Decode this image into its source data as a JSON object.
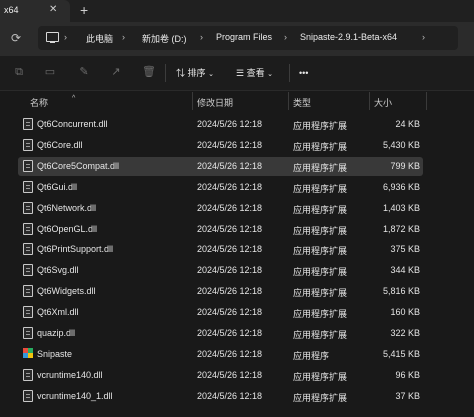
{
  "tab": {
    "title": "x64",
    "close_glyph": "✕",
    "new_glyph": "+"
  },
  "breadcrumb": {
    "items": [
      "此电脑",
      "新加卷 (D:)",
      "Program Files",
      "Snipaste-2.9.1-Beta-x64"
    ],
    "separator": "›",
    "trailing": "›"
  },
  "toolbar": {
    "sort_label": "排序",
    "view_label": "查看",
    "more_label": "•••",
    "icons": [
      "copy-icon",
      "paste-icon",
      "rename-icon",
      "share-icon",
      "delete-icon"
    ]
  },
  "columns": {
    "name": "名称",
    "modified": "修改日期",
    "type": "类型",
    "size": "大小"
  },
  "files": [
    {
      "name": "Qt6Concurrent.dll",
      "modified": "2024/5/26 12:18",
      "type": "应用程序扩展",
      "size": "24 KB",
      "icon": "dll-file-icon"
    },
    {
      "name": "Qt6Core.dll",
      "modified": "2024/5/26 12:18",
      "type": "应用程序扩展",
      "size": "5,430 KB",
      "icon": "dll-file-icon"
    },
    {
      "name": "Qt6Core5Compat.dll",
      "modified": "2024/5/26 12:18",
      "type": "应用程序扩展",
      "size": "799 KB",
      "icon": "dll-file-icon",
      "selected": true
    },
    {
      "name": "Qt6Gui.dll",
      "modified": "2024/5/26 12:18",
      "type": "应用程序扩展",
      "size": "6,936 KB",
      "icon": "dll-file-icon"
    },
    {
      "name": "Qt6Network.dll",
      "modified": "2024/5/26 12:18",
      "type": "应用程序扩展",
      "size": "1,403 KB",
      "icon": "dll-file-icon"
    },
    {
      "name": "Qt6OpenGL.dll",
      "modified": "2024/5/26 12:18",
      "type": "应用程序扩展",
      "size": "1,872 KB",
      "icon": "dll-file-icon"
    },
    {
      "name": "Qt6PrintSupport.dll",
      "modified": "2024/5/26 12:18",
      "type": "应用程序扩展",
      "size": "375 KB",
      "icon": "dll-file-icon"
    },
    {
      "name": "Qt6Svg.dll",
      "modified": "2024/5/26 12:18",
      "type": "应用程序扩展",
      "size": "344 KB",
      "icon": "dll-file-icon"
    },
    {
      "name": "Qt6Widgets.dll",
      "modified": "2024/5/26 12:18",
      "type": "应用程序扩展",
      "size": "5,816 KB",
      "icon": "dll-file-icon"
    },
    {
      "name": "Qt6Xml.dll",
      "modified": "2024/5/26 12:18",
      "type": "应用程序扩展",
      "size": "160 KB",
      "icon": "dll-file-icon"
    },
    {
      "name": "quazip.dll",
      "modified": "2024/5/26 12:18",
      "type": "应用程序扩展",
      "size": "322 KB",
      "icon": "dll-file-icon"
    },
    {
      "name": "Snipaste",
      "modified": "2024/5/26 12:18",
      "type": "应用程序",
      "size": "5,415 KB",
      "icon": "snipaste-app-icon"
    },
    {
      "name": "vcruntime140.dll",
      "modified": "2024/5/26 12:18",
      "type": "应用程序扩展",
      "size": "96 KB",
      "icon": "dll-file-icon"
    },
    {
      "name": "vcruntime140_1.dll",
      "modified": "2024/5/26 12:18",
      "type": "应用程序扩展",
      "size": "37 KB",
      "icon": "dll-file-icon"
    }
  ],
  "colors": {
    "background": "#191919",
    "selected_row": "#393939",
    "text": "#e6e6e6"
  }
}
